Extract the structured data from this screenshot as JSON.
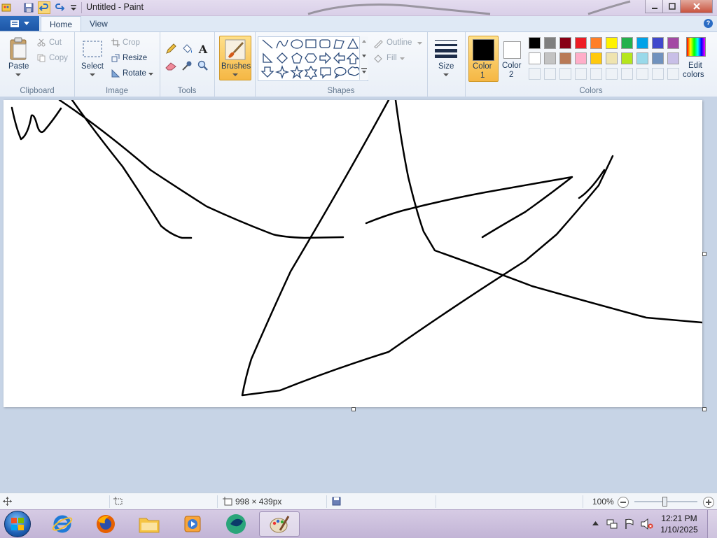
{
  "window": {
    "title": "Untitled - Paint"
  },
  "tabs": {
    "file_label": "",
    "home": "Home",
    "view": "View"
  },
  "clipboard": {
    "paste": "Paste",
    "cut": "Cut",
    "copy": "Copy",
    "group": "Clipboard"
  },
  "image": {
    "select": "Select",
    "crop": "Crop",
    "resize": "Resize",
    "rotate": "Rotate",
    "group": "Image"
  },
  "tools": {
    "group": "Tools",
    "text_glyph": "A"
  },
  "brushes": {
    "label": "Brushes"
  },
  "shapes": {
    "outline": "Outline",
    "fill": "Fill",
    "group": "Shapes"
  },
  "size": {
    "label": "Size"
  },
  "colors": {
    "color1_label": "Color",
    "color1_num": "1",
    "color2_label": "Color",
    "color2_num": "2",
    "edit_label": "Edit",
    "edit_label2": "colors",
    "group": "Colors",
    "color1": "#000000",
    "color2": "#ffffff",
    "palette_row1": [
      "#000000",
      "#7f7f7f",
      "#880015",
      "#ed1c24",
      "#ff7f27",
      "#fff200",
      "#22b14c",
      "#00a2e8",
      "#3f48cc",
      "#a349a4"
    ],
    "palette_row2": [
      "#ffffff",
      "#c3c3c3",
      "#b97a57",
      "#ffaec9",
      "#ffc90e",
      "#efe4b0",
      "#b5e61d",
      "#99d9ea",
      "#7092be",
      "#c8bfe7"
    ]
  },
  "status": {
    "canvas_size": "998 × 439px",
    "zoom": "100%"
  },
  "taskbar": {
    "time": "12:21 PM",
    "date": "1/10/2025"
  }
}
